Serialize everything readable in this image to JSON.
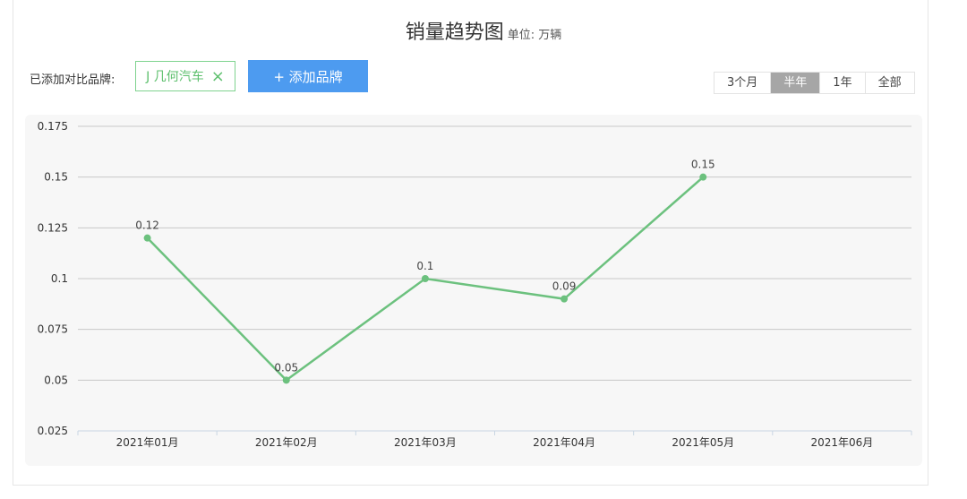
{
  "header": {
    "title": "销量趋势图",
    "unit": "单位: 万辆"
  },
  "brands": {
    "label": "已添加对比品牌:",
    "items": [
      {
        "name": "J 几何汽车"
      }
    ],
    "remove_icon": "×",
    "add_button": "+ 添加品牌"
  },
  "range_tabs": [
    {
      "label": "3个月",
      "active": false
    },
    {
      "label": "半年",
      "active": true
    },
    {
      "label": "1年",
      "active": false
    },
    {
      "label": "全部",
      "active": false
    }
  ],
  "chart_data": {
    "type": "line",
    "categories": [
      "2021年01月",
      "2021年02月",
      "2021年03月",
      "2021年04月",
      "2021年05月",
      "2021年06月"
    ],
    "series": [
      {
        "name": "J 几何汽车",
        "values": [
          0.12,
          0.05,
          0.1,
          0.09,
          0.15,
          null
        ],
        "color": "#6cc17e"
      }
    ],
    "yticks": [
      "0.025",
      "0.05",
      "0.075",
      "0.1",
      "0.125",
      "0.15",
      "0.175"
    ],
    "ylim": [
      0.025,
      0.175
    ],
    "grid": true
  }
}
